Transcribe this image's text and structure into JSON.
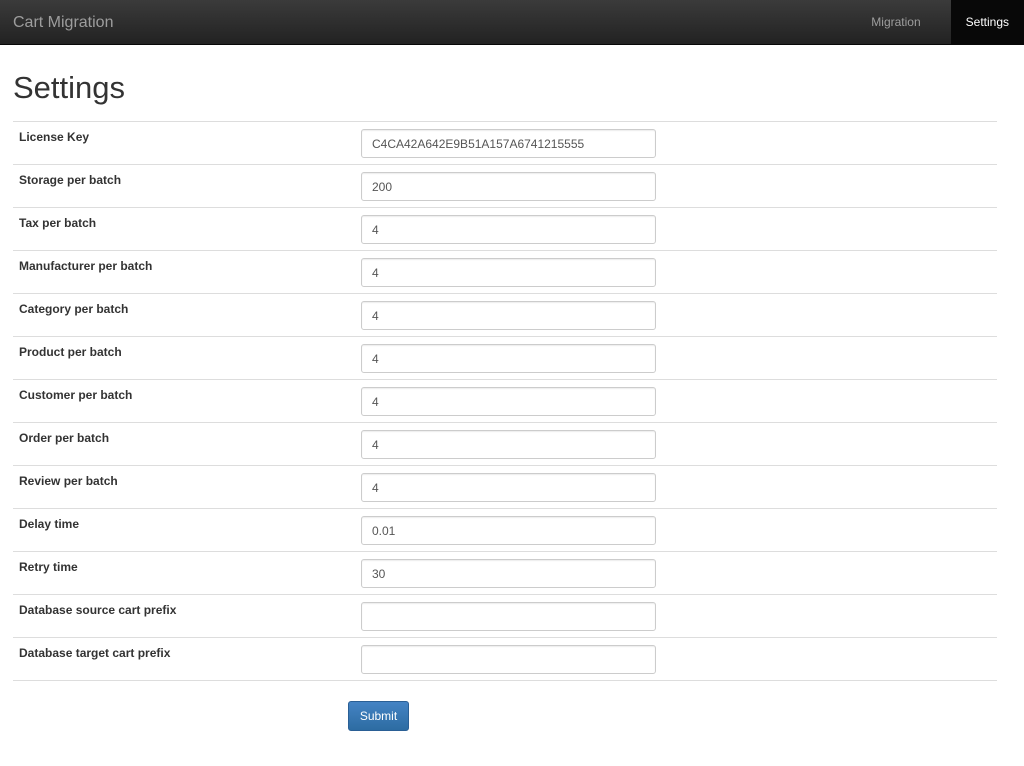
{
  "navbar": {
    "brand": "Cart Migration",
    "items": [
      {
        "label": "Migration",
        "active": false
      },
      {
        "label": "Settings",
        "active": true
      }
    ]
  },
  "page": {
    "title": "Settings"
  },
  "settings": [
    {
      "label": "License Key",
      "value": "C4CA42A642E9B51A157A6741215555"
    },
    {
      "label": "Storage per batch",
      "value": "200"
    },
    {
      "label": "Tax per batch",
      "value": "4"
    },
    {
      "label": "Manufacturer per batch",
      "value": "4"
    },
    {
      "label": "Category per batch",
      "value": "4"
    },
    {
      "label": "Product per batch",
      "value": "4"
    },
    {
      "label": "Customer per batch",
      "value": "4"
    },
    {
      "label": "Order per batch",
      "value": "4"
    },
    {
      "label": "Review per batch",
      "value": "4"
    },
    {
      "label": "Delay time",
      "value": "0.01"
    },
    {
      "label": "Retry time",
      "value": "30"
    },
    {
      "label": "Database source cart prefix",
      "value": ""
    },
    {
      "label": "Database target cart prefix",
      "value": ""
    }
  ],
  "form": {
    "submit_label": "Submit"
  },
  "colors": {
    "navbar_bg": "#222222",
    "active_nav_bg": "#080808",
    "submit_bg": "#337ab7"
  }
}
